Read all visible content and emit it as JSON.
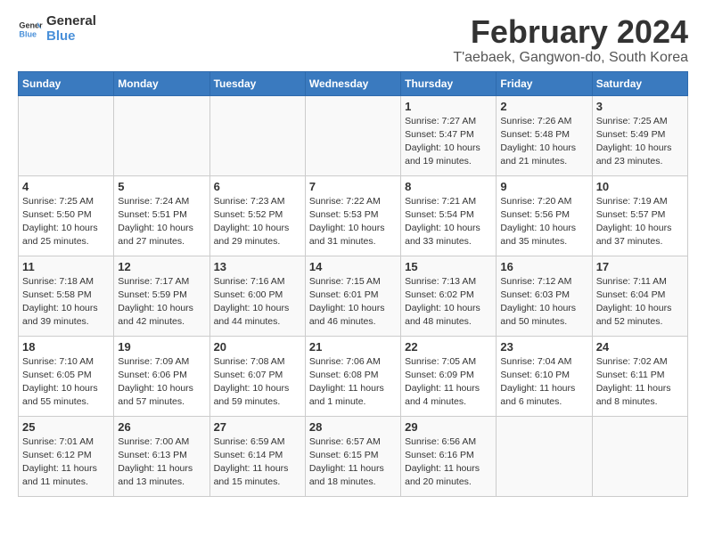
{
  "logo": {
    "line1": "General",
    "line2": "Blue"
  },
  "title": "February 2024",
  "subtitle": "T'aebaek, Gangwon-do, South Korea",
  "weekdays": [
    "Sunday",
    "Monday",
    "Tuesday",
    "Wednesday",
    "Thursday",
    "Friday",
    "Saturday"
  ],
  "weeks": [
    [
      {
        "day": "",
        "info": ""
      },
      {
        "day": "",
        "info": ""
      },
      {
        "day": "",
        "info": ""
      },
      {
        "day": "",
        "info": ""
      },
      {
        "day": "1",
        "info": "Sunrise: 7:27 AM\nSunset: 5:47 PM\nDaylight: 10 hours\nand 19 minutes."
      },
      {
        "day": "2",
        "info": "Sunrise: 7:26 AM\nSunset: 5:48 PM\nDaylight: 10 hours\nand 21 minutes."
      },
      {
        "day": "3",
        "info": "Sunrise: 7:25 AM\nSunset: 5:49 PM\nDaylight: 10 hours\nand 23 minutes."
      }
    ],
    [
      {
        "day": "4",
        "info": "Sunrise: 7:25 AM\nSunset: 5:50 PM\nDaylight: 10 hours\nand 25 minutes."
      },
      {
        "day": "5",
        "info": "Sunrise: 7:24 AM\nSunset: 5:51 PM\nDaylight: 10 hours\nand 27 minutes."
      },
      {
        "day": "6",
        "info": "Sunrise: 7:23 AM\nSunset: 5:52 PM\nDaylight: 10 hours\nand 29 minutes."
      },
      {
        "day": "7",
        "info": "Sunrise: 7:22 AM\nSunset: 5:53 PM\nDaylight: 10 hours\nand 31 minutes."
      },
      {
        "day": "8",
        "info": "Sunrise: 7:21 AM\nSunset: 5:54 PM\nDaylight: 10 hours\nand 33 minutes."
      },
      {
        "day": "9",
        "info": "Sunrise: 7:20 AM\nSunset: 5:56 PM\nDaylight: 10 hours\nand 35 minutes."
      },
      {
        "day": "10",
        "info": "Sunrise: 7:19 AM\nSunset: 5:57 PM\nDaylight: 10 hours\nand 37 minutes."
      }
    ],
    [
      {
        "day": "11",
        "info": "Sunrise: 7:18 AM\nSunset: 5:58 PM\nDaylight: 10 hours\nand 39 minutes."
      },
      {
        "day": "12",
        "info": "Sunrise: 7:17 AM\nSunset: 5:59 PM\nDaylight: 10 hours\nand 42 minutes."
      },
      {
        "day": "13",
        "info": "Sunrise: 7:16 AM\nSunset: 6:00 PM\nDaylight: 10 hours\nand 44 minutes."
      },
      {
        "day": "14",
        "info": "Sunrise: 7:15 AM\nSunset: 6:01 PM\nDaylight: 10 hours\nand 46 minutes."
      },
      {
        "day": "15",
        "info": "Sunrise: 7:13 AM\nSunset: 6:02 PM\nDaylight: 10 hours\nand 48 minutes."
      },
      {
        "day": "16",
        "info": "Sunrise: 7:12 AM\nSunset: 6:03 PM\nDaylight: 10 hours\nand 50 minutes."
      },
      {
        "day": "17",
        "info": "Sunrise: 7:11 AM\nSunset: 6:04 PM\nDaylight: 10 hours\nand 52 minutes."
      }
    ],
    [
      {
        "day": "18",
        "info": "Sunrise: 7:10 AM\nSunset: 6:05 PM\nDaylight: 10 hours\nand 55 minutes."
      },
      {
        "day": "19",
        "info": "Sunrise: 7:09 AM\nSunset: 6:06 PM\nDaylight: 10 hours\nand 57 minutes."
      },
      {
        "day": "20",
        "info": "Sunrise: 7:08 AM\nSunset: 6:07 PM\nDaylight: 10 hours\nand 59 minutes."
      },
      {
        "day": "21",
        "info": "Sunrise: 7:06 AM\nSunset: 6:08 PM\nDaylight: 11 hours\nand 1 minute."
      },
      {
        "day": "22",
        "info": "Sunrise: 7:05 AM\nSunset: 6:09 PM\nDaylight: 11 hours\nand 4 minutes."
      },
      {
        "day": "23",
        "info": "Sunrise: 7:04 AM\nSunset: 6:10 PM\nDaylight: 11 hours\nand 6 minutes."
      },
      {
        "day": "24",
        "info": "Sunrise: 7:02 AM\nSunset: 6:11 PM\nDaylight: 11 hours\nand 8 minutes."
      }
    ],
    [
      {
        "day": "25",
        "info": "Sunrise: 7:01 AM\nSunset: 6:12 PM\nDaylight: 11 hours\nand 11 minutes."
      },
      {
        "day": "26",
        "info": "Sunrise: 7:00 AM\nSunset: 6:13 PM\nDaylight: 11 hours\nand 13 minutes."
      },
      {
        "day": "27",
        "info": "Sunrise: 6:59 AM\nSunset: 6:14 PM\nDaylight: 11 hours\nand 15 minutes."
      },
      {
        "day": "28",
        "info": "Sunrise: 6:57 AM\nSunset: 6:15 PM\nDaylight: 11 hours\nand 18 minutes."
      },
      {
        "day": "29",
        "info": "Sunrise: 6:56 AM\nSunset: 6:16 PM\nDaylight: 11 hours\nand 20 minutes."
      },
      {
        "day": "",
        "info": ""
      },
      {
        "day": "",
        "info": ""
      }
    ]
  ]
}
